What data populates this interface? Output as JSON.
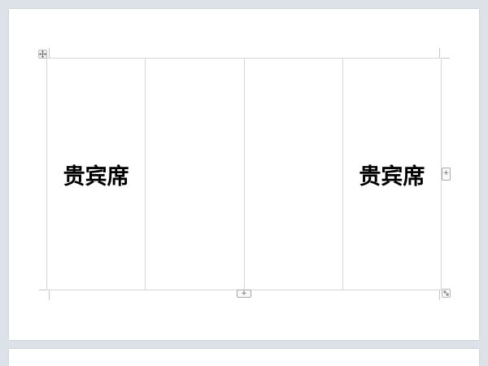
{
  "document": {
    "table": {
      "rows": [
        {
          "cells": [
            {
              "text": "贵宾席"
            },
            {
              "text": ""
            },
            {
              "text": ""
            },
            {
              "text": "贵宾席"
            }
          ]
        }
      ]
    },
    "handles": {
      "move_icon": "move-icon",
      "add_column_label": "+",
      "add_row_label": "+",
      "resize_icon": "resize-icon"
    }
  },
  "colors": {
    "workspace_background": "#dde2e9",
    "page_background": "#ffffff",
    "table_border": "#d6d6d6",
    "text": "#000000"
  }
}
